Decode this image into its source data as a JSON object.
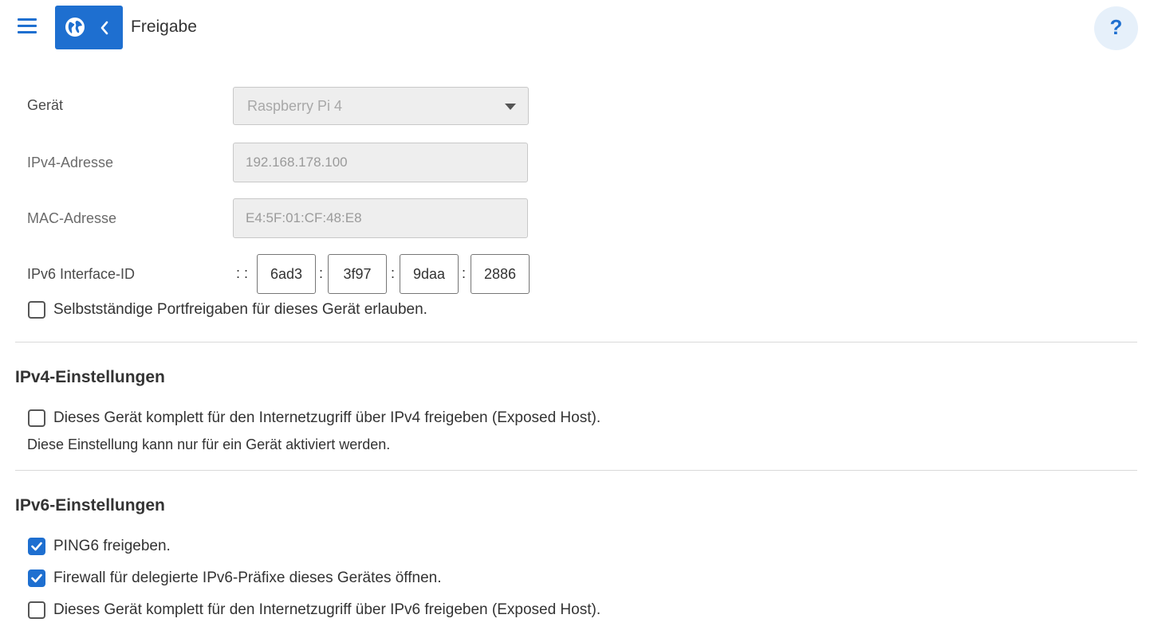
{
  "header": {
    "title": "Freigabe",
    "help_label": "?"
  },
  "device": {
    "label": "Gerät",
    "selected": "Raspberry Pi 4"
  },
  "ipv4_address": {
    "label": "IPv4-Adresse",
    "value": "192.168.178.100"
  },
  "mac_address": {
    "label": "MAC-Adresse",
    "value": "E4:5F:01:CF:48:E8"
  },
  "ipv6_interface": {
    "label": "IPv6 Interface-ID",
    "prefix": ": :",
    "separator": ":",
    "segments": [
      "6ad3",
      "3f97",
      "9daa",
      "2886"
    ]
  },
  "allow_port_forwarding": {
    "label": "Selbstständige Portfreigaben für dieses Gerät erlauben.",
    "checked": false
  },
  "ipv4_settings": {
    "heading": "IPv4-Einstellungen",
    "exposed_host": {
      "label": "Dieses Gerät komplett für den Internetzugriff über IPv4 freigeben (Exposed Host).",
      "checked": false
    },
    "note": "Diese Einstellung kann nur für ein Gerät aktiviert werden."
  },
  "ipv6_settings": {
    "heading": "IPv6-Einstellungen",
    "ping6": {
      "label": "PING6 freigeben.",
      "checked": true
    },
    "firewall": {
      "label": "Firewall für delegierte IPv6-Präfixe dieses Gerätes öffnen.",
      "checked": true
    },
    "exposed_host": {
      "label": "Dieses Gerät komplett für den Internetzugriff über IPv6 freigeben (Exposed Host).",
      "checked": false
    }
  },
  "colors": {
    "accent": "#1e6fd0",
    "help_bg": "#e6f0fa"
  }
}
